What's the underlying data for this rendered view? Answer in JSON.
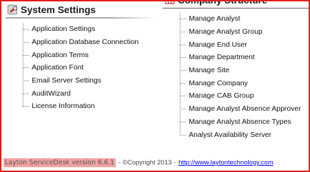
{
  "system_settings": {
    "title": "System Settings",
    "items": [
      {
        "label": "Application Settings"
      },
      {
        "label": "Application Database Connection"
      },
      {
        "label": "Application Terms"
      },
      {
        "label": "Application Font"
      },
      {
        "label": "Email Server Settings"
      },
      {
        "label": "AuditWizard"
      },
      {
        "label": "License Information"
      }
    ]
  },
  "company_structure": {
    "title": "Company Structure",
    "items": [
      {
        "label": "Manage Analyst"
      },
      {
        "label": "Manage Analyst Group"
      },
      {
        "label": "Manage End User"
      },
      {
        "label": "Manage Department"
      },
      {
        "label": "Manage Site"
      },
      {
        "label": "Manage Company"
      },
      {
        "label": "Manage CAB Group"
      },
      {
        "label": "Manage Analyst Absence Approver"
      },
      {
        "label": "Manage Analyst Absence Types"
      },
      {
        "label": "Analyst Availability Server"
      }
    ]
  },
  "footer": {
    "version": "Layton ServiceDesk version 6.6.1",
    "copyright": "- ©Copyright 2013 -",
    "link": "http://www.laytontechnology.com"
  },
  "colors": {
    "frame": "#e31b1b",
    "version_highlight": "#f4a2a2",
    "link": "#0000ee"
  }
}
